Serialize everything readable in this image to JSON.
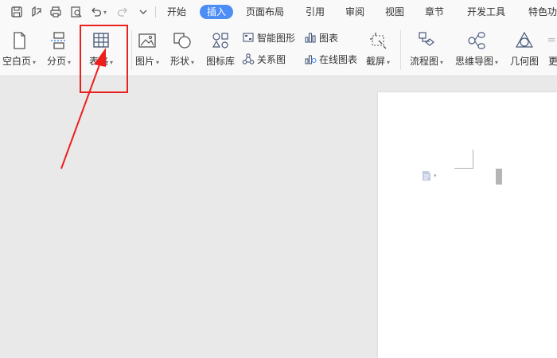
{
  "menubar": {
    "tabs": [
      {
        "label": "开始"
      },
      {
        "label": "插入",
        "active": true
      },
      {
        "label": "页面布局"
      },
      {
        "label": "引用"
      },
      {
        "label": "审阅"
      },
      {
        "label": "视图"
      },
      {
        "label": "章节"
      },
      {
        "label": "开发工具"
      },
      {
        "label": "特色功"
      }
    ]
  },
  "ribbon": {
    "blank_page": "空白页",
    "page_break": "分页",
    "table": "表格",
    "picture": "图片",
    "shape": "形状",
    "icon_library": "图标库",
    "smart_graphic": "智能图形",
    "relation_chart": "关系图",
    "chart": "图表",
    "online_chart": "在线图表",
    "screenshot": "截屏",
    "flowchart": "流程图",
    "mindmap": "思维导图",
    "geometry": "几何图",
    "more": "更",
    "caret": "▾"
  },
  "colors": {
    "accent": "#4c8df6",
    "highlight": "#e8201f",
    "icon": "#4a5a7a"
  }
}
